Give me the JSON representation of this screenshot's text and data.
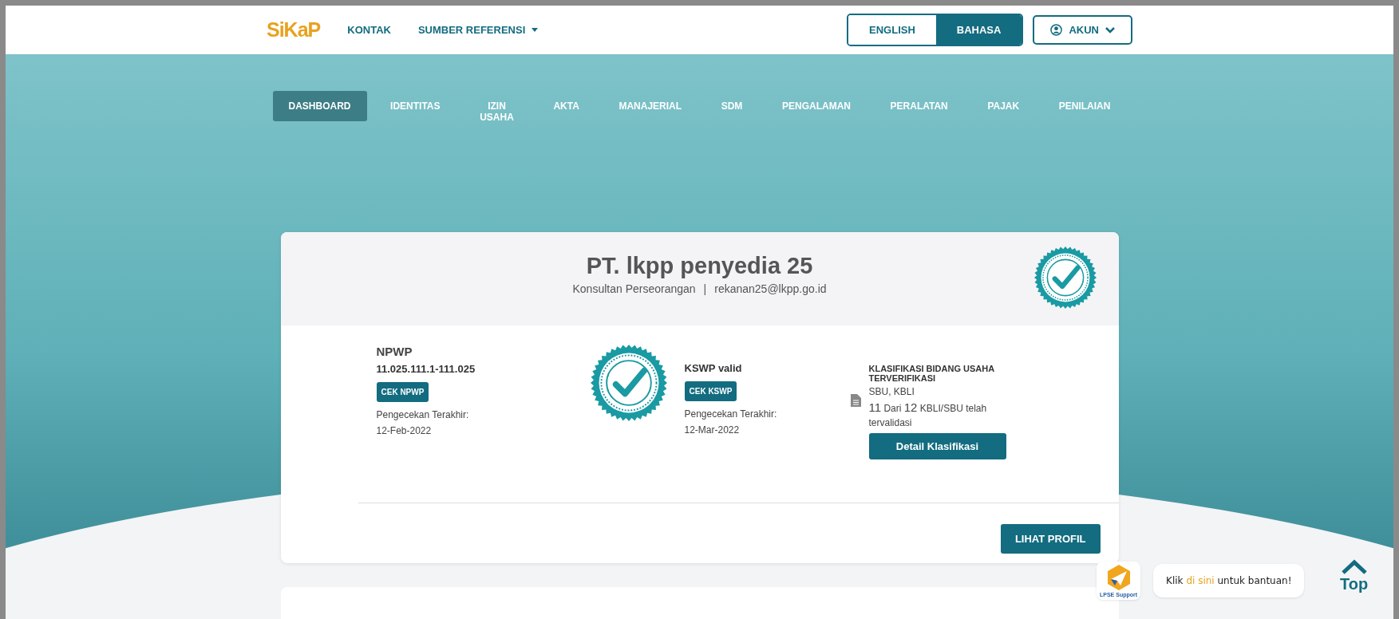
{
  "header": {
    "logo": "SiKaP",
    "links": [
      {
        "label": "KONTAK",
        "dropdown": false
      },
      {
        "label": "SUMBER REFERENSI",
        "dropdown": true
      }
    ],
    "languages": [
      {
        "label": "ENGLISH",
        "selected": false
      },
      {
        "label": "BAHASA",
        "selected": true
      }
    ],
    "account": "AKUN"
  },
  "nav_tabs": [
    {
      "label": "DASHBOARD",
      "selected": true
    },
    {
      "label": "IDENTITAS",
      "selected": false
    },
    {
      "label": "IZIN USAHA",
      "selected": false
    },
    {
      "label": "AKTA",
      "selected": false
    },
    {
      "label": "MANAJERIAL",
      "selected": false
    },
    {
      "label": "SDM",
      "selected": false
    },
    {
      "label": "PENGALAMAN",
      "selected": false
    },
    {
      "label": "PERALATAN",
      "selected": false
    },
    {
      "label": "PAJAK",
      "selected": false
    },
    {
      "label": "PENILAIAN",
      "selected": false
    }
  ],
  "profile_card": {
    "company_name": "PT. lkpp penyedia 25",
    "company_type": "Konsultan Perseorangan",
    "separator": "|",
    "email": "rekanan25@lkpp.go.id",
    "npwp": {
      "title": "NPWP",
      "number": "11.025.111.1-111.025",
      "button": "CEK NPWP",
      "last_check_label": "Pengecekan Terakhir:",
      "last_check_date": "12-Feb-2022"
    },
    "kswp": {
      "status": "KSWP valid",
      "button": "CEK KSWP",
      "last_check_label": "Pengecekan Terakhir:",
      "last_check_date": "12-Mar-2022"
    },
    "classification": {
      "title": "KLASIFIKASI BIDANG USAHA TERVERIFIKASI",
      "types": "SBU, KBLI",
      "summary": [
        {
          "kind": "number",
          "text": "11"
        },
        {
          "kind": "text",
          "text": "Dari"
        },
        {
          "kind": "number",
          "text": "12"
        },
        {
          "kind": "text",
          "text": "KBLI/SBU telah tervalidasi"
        }
      ],
      "button": "Detail Klasifikasi"
    },
    "profile_button": "LIHAT PROFIL"
  },
  "support": {
    "label": "LPSE Support",
    "message_before": "Klik",
    "message_link": "di sini",
    "message_after": "untuk bantuan!"
  },
  "back_to_top": "Top"
}
